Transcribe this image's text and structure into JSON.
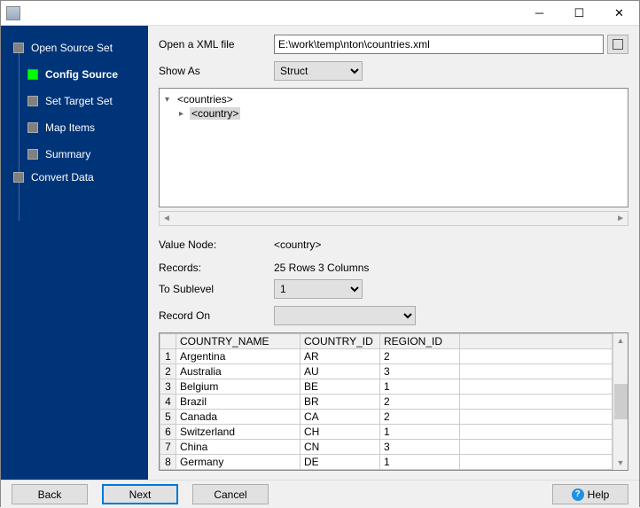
{
  "sidebar": {
    "items": [
      {
        "label": "Open Source Set",
        "active": false,
        "sub": false
      },
      {
        "label": "Config Source",
        "active": true,
        "sub": true
      },
      {
        "label": "Set Target Set",
        "active": false,
        "sub": true
      },
      {
        "label": "Map Items",
        "active": false,
        "sub": true
      },
      {
        "label": "Summary",
        "active": false,
        "sub": true
      },
      {
        "label": "Convert Data",
        "active": false,
        "sub": false
      }
    ]
  },
  "form": {
    "open_label": "Open a XML file",
    "open_value": "E:\\work\\temp\\nton\\countries.xml",
    "showas_label": "Show As",
    "showas_value": "Struct",
    "value_node_label": "Value Node:",
    "value_node_value": "<country>",
    "records_label": "Records:",
    "records_value": "25 Rows    3 Columns",
    "sublevel_label": "To Sublevel",
    "sublevel_value": "1",
    "recordon_label": "Record On",
    "recordon_value": ""
  },
  "tree": {
    "root": "<countries>",
    "child": "<country>"
  },
  "grid": {
    "headers": [
      "COUNTRY_NAME",
      "COUNTRY_ID",
      "REGION_ID"
    ],
    "rows": [
      [
        "Argentina",
        "AR",
        "2"
      ],
      [
        "Australia",
        "AU",
        "3"
      ],
      [
        "Belgium",
        "BE",
        "1"
      ],
      [
        "Brazil",
        "BR",
        "2"
      ],
      [
        "Canada",
        "CA",
        "2"
      ],
      [
        "Switzerland",
        "CH",
        "1"
      ],
      [
        "China",
        "CN",
        "3"
      ],
      [
        "Germany",
        "DE",
        "1"
      ]
    ]
  },
  "buttons": {
    "back": "Back",
    "next": "Next",
    "cancel": "Cancel",
    "help": "Help"
  },
  "chart_data": {
    "type": "table",
    "headers": [
      "COUNTRY_NAME",
      "COUNTRY_ID",
      "REGION_ID"
    ],
    "rows": [
      [
        "Argentina",
        "AR",
        2
      ],
      [
        "Australia",
        "AU",
        3
      ],
      [
        "Belgium",
        "BE",
        1
      ],
      [
        "Brazil",
        "BR",
        2
      ],
      [
        "Canada",
        "CA",
        2
      ],
      [
        "Switzerland",
        "CH",
        1
      ],
      [
        "China",
        "CN",
        3
      ],
      [
        "Germany",
        "DE",
        1
      ]
    ],
    "total_rows": 25,
    "total_columns": 3
  }
}
